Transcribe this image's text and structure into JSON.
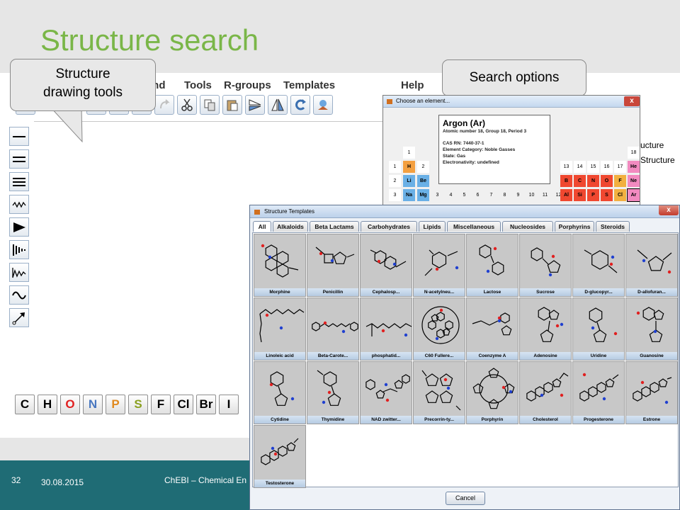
{
  "slide": {
    "title": "Structure search",
    "page_number": "32",
    "date": "30.08.2015",
    "footer_text": "ChEBI – Chemical En",
    "title_color": "#7ab648",
    "footer_color": "#1f6c75"
  },
  "callouts": {
    "drawing_tools": [
      "Structure",
      "drawing tools"
    ],
    "search_options": "Search options"
  },
  "editor": {
    "menu": [
      "ond",
      "Tools",
      "R-groups",
      "Templates",
      "Help"
    ],
    "toolbar_icons": [
      "new-icon",
      "templates-icon",
      "add-atom-icon",
      "edit-icon",
      "redo-icon",
      "cut-icon",
      "copy-icon",
      "paste-icon",
      "flip-horizontal-icon",
      "flip-vertical-icon",
      "rotate-icon",
      "clean-icon"
    ],
    "bond_tools": [
      "single-bond-icon",
      "double-bond-icon",
      "triple-bond-icon",
      "any-bond-icon",
      "wedge-bond-icon",
      "hash-bond-icon",
      "wavy-bond-icon",
      "chain-icon",
      "arrow-tool-icon"
    ],
    "elements": [
      {
        "symbol": "C",
        "color": "#000000"
      },
      {
        "symbol": "H",
        "color": "#000000"
      },
      {
        "symbol": "O",
        "color": "#e02020"
      },
      {
        "symbol": "N",
        "color": "#4a78c0"
      },
      {
        "symbol": "P",
        "color": "#e08a20"
      },
      {
        "symbol": "S",
        "color": "#8aa020"
      },
      {
        "symbol": "F",
        "color": "#000000"
      },
      {
        "symbol": "Cl",
        "color": "#000000"
      },
      {
        "symbol": "Br",
        "color": "#000000"
      },
      {
        "symbol": "I",
        "color": "#000000"
      }
    ]
  },
  "periodic_dialog": {
    "title": "Choose an element...",
    "close": "x",
    "info": {
      "name": "Argon (Ar)",
      "line1": "Atomic number 18, Group 18, Period 3",
      "cas": "CAS RN: 7440-37-1",
      "category": "Element Category: Noble Gasses",
      "state": "State: Gas",
      "electronegativity": "Electronativity: undefined"
    },
    "group_numbers_left": [
      "1",
      "2"
    ],
    "period_numbers": [
      "1",
      "2",
      "3"
    ],
    "group_numbers_right": [
      "13",
      "14",
      "15",
      "16",
      "17"
    ],
    "group_18": "18",
    "transition_numbers": [
      "3",
      "4",
      "5",
      "6",
      "7",
      "8",
      "9",
      "10",
      "11",
      "12"
    ],
    "elements_left": [
      "H",
      "Li",
      "Be",
      "Na",
      "Mg"
    ],
    "elements_right_row2": [
      "B",
      "C",
      "N",
      "O",
      "F",
      "Ne"
    ],
    "elements_right_row3": [
      "Al",
      "Si",
      "P",
      "S",
      "Cl",
      "Ar"
    ],
    "he": "He"
  },
  "behind_text": [
    "ucture",
    "Structure"
  ],
  "templates_dialog": {
    "title": "Structure Templates",
    "close": "x",
    "tabs": [
      "All",
      "Alkaloids",
      "Beta Lactams",
      "Carbohydrates",
      "Lipids",
      "Miscellaneous",
      "Nucleosides",
      "Porphyrins",
      "Steroids"
    ],
    "templates": [
      "Morphine",
      "Penicillin",
      "Cephalosp...",
      "N-acetylneu...",
      "Lactose",
      "Sucrose",
      "D-glucopyr...",
      "D-allofuran...",
      "Linoleic acid",
      "Beta-Carote...",
      "phosphatid...",
      "C60 Fullere...",
      "Coenzyme A",
      "Adenosine",
      "Uridine",
      "Guanosine",
      "Cytidine",
      "Thymidine",
      "NAD zwitter...",
      "Precorrin-ty...",
      "Porphyrin",
      "Cholesterol",
      "Progesterone",
      "Estrone",
      "Testosterone"
    ],
    "cancel": "Cancel"
  }
}
